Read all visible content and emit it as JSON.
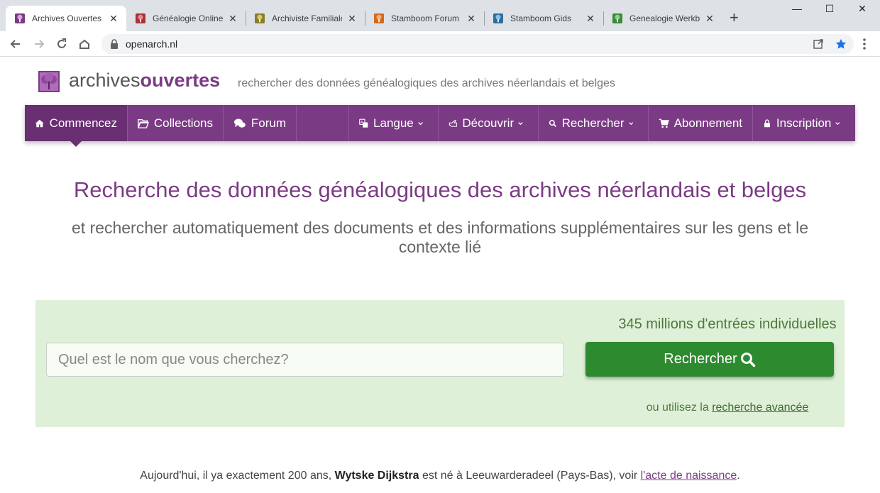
{
  "browser": {
    "tabs": [
      {
        "title": "Archives Ouvertes",
        "color": "#7b3b84"
      },
      {
        "title": "Généalogie Online",
        "color": "#a33"
      },
      {
        "title": "Archiviste Familiale",
        "color": "#8a7d2a"
      },
      {
        "title": "Stamboom Forum",
        "color": "#d2691e"
      },
      {
        "title": "Stamboom Gids",
        "color": "#2d6ea0"
      },
      {
        "title": "Genealogie Werkba",
        "color": "#3a8a3a"
      }
    ],
    "url": "openarch.nl"
  },
  "header": {
    "brand_plain": "archives",
    "brand_bold": "ouvertes",
    "tagline": "rechercher des données généalogiques des archives néerlandais et belges"
  },
  "nav": {
    "commencez": "Commencez",
    "collections": "Collections",
    "forum": "Forum",
    "langue": "Langue",
    "decouvrir": "Découvrir",
    "rechercher": "Rechercher",
    "abonnement": "Abonnement",
    "inscription": "Inscription"
  },
  "hero": {
    "title": "Recherche des données généalogiques des archives néerlandais et belges",
    "subtitle": "et rechercher automatiquement des documents et des informations supplémentaires sur les gens et le contexte lié"
  },
  "search": {
    "count": "345 millions d'entrées individuelles",
    "placeholder": "Quel est le nom que vous cherchez?",
    "button": "Rechercher",
    "adv_prefix": "ou utilisez la ",
    "adv_link": "recherche avancée"
  },
  "today": {
    "prefix": "Aujourd'hui, il ya exactement 200 ans, ",
    "name": "Wytske Dijkstra",
    "middle": " est né à Leeuwarderadeel (Pays-Bas), voir ",
    "link": "l'acte de naissance",
    "suffix": "."
  }
}
